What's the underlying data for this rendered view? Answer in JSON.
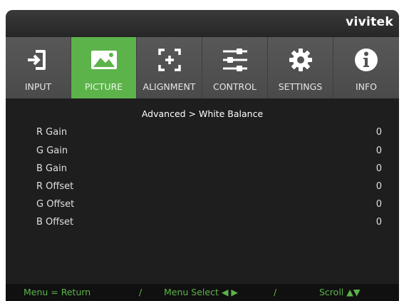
{
  "brand": {
    "logo": "vivitek"
  },
  "tabs": [
    {
      "id": "input",
      "label": "INPUT",
      "icon": "input-icon",
      "active": false
    },
    {
      "id": "picture",
      "label": "PICTURE",
      "icon": "picture-icon",
      "active": true
    },
    {
      "id": "alignment",
      "label": "ALIGNMENT",
      "icon": "alignment-icon",
      "active": false
    },
    {
      "id": "control",
      "label": "CONTROL",
      "icon": "control-sliders-icon",
      "active": false
    },
    {
      "id": "settings",
      "label": "SETTINGS",
      "icon": "gear-icon",
      "active": false
    },
    {
      "id": "info",
      "label": "INFO",
      "icon": "info-icon",
      "active": false
    }
  ],
  "breadcrumb": "Advanced > White Balance",
  "settings": [
    {
      "name": "R Gain",
      "value": "0"
    },
    {
      "name": "G Gain",
      "value": "0"
    },
    {
      "name": "B Gain",
      "value": "0"
    },
    {
      "name": "R Offset",
      "value": "0"
    },
    {
      "name": "G Offset",
      "value": "0"
    },
    {
      "name": "B Offset",
      "value": "0"
    }
  ],
  "footer": {
    "menu_return": "Menu = Return",
    "sep1": "/",
    "menu_select": "Menu Select ◀ ▶",
    "sep2": "/",
    "scroll": "Scroll ▲▼"
  },
  "colors": {
    "accent": "#5cb34a",
    "panel": "#1e1e1e",
    "tab": "#555555"
  }
}
